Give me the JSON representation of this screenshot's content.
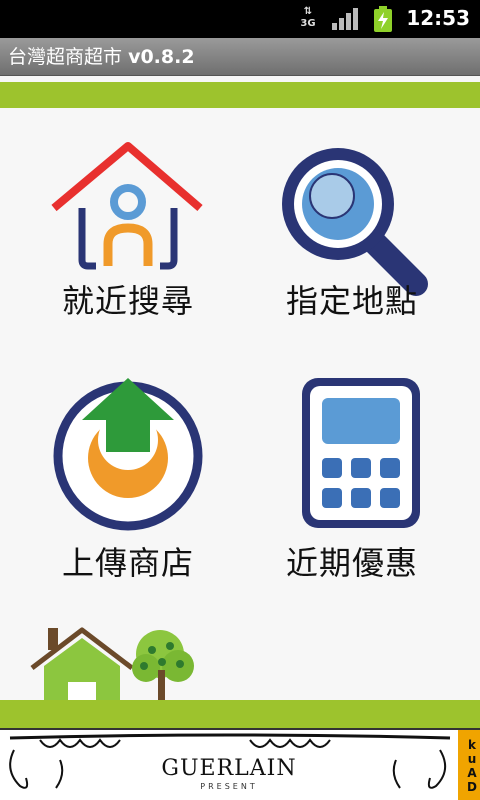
{
  "status_bar": {
    "time": "12:53",
    "network": "3G"
  },
  "app": {
    "title": "台灣超商超市",
    "version": "v0.8.2"
  },
  "menu": [
    {
      "label": "就近搜尋",
      "icon": "house-icon"
    },
    {
      "label": "指定地點",
      "icon": "magnifier-icon"
    },
    {
      "label": "上傳商店",
      "icon": "upload-icon"
    },
    {
      "label": "近期優惠",
      "icon": "calculator-icon"
    }
  ],
  "ad": {
    "brand": "GUERLAIN",
    "tagline": "PRESENT",
    "network": "kuAD"
  },
  "colors": {
    "accent_green": "#9dc32d",
    "navy": "#2a3575",
    "blue": "#5b9bd5",
    "orange": "#f09a2a",
    "red": "#e8302e"
  }
}
